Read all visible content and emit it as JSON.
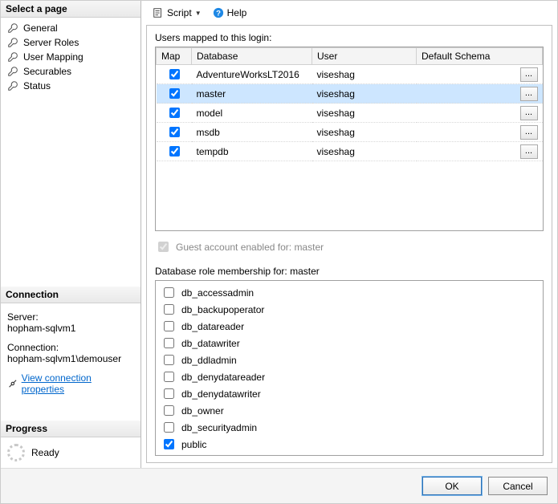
{
  "left": {
    "select_page_header": "Select a page",
    "nav": [
      {
        "label": "General"
      },
      {
        "label": "Server Roles"
      },
      {
        "label": "User Mapping"
      },
      {
        "label": "Securables"
      },
      {
        "label": "Status"
      }
    ],
    "connection_header": "Connection",
    "server_label": "Server:",
    "server_value": "hopham-sqlvm1",
    "connection_label": "Connection:",
    "connection_value": "hopham-sqlvm1\\demouser",
    "view_conn_link": "View connection properties",
    "progress_header": "Progress",
    "progress_status": "Ready"
  },
  "toolbar": {
    "script_label": "Script",
    "help_label": "Help"
  },
  "mapping": {
    "label": "Users mapped to this login:",
    "columns": {
      "map": "Map",
      "database": "Database",
      "user": "User",
      "schema": "Default Schema"
    },
    "rows": [
      {
        "checked": true,
        "database": "AdventureWorksLT2016",
        "user": "viseshag",
        "schema": "",
        "selected": false
      },
      {
        "checked": true,
        "database": "master",
        "user": "viseshag",
        "schema": "",
        "selected": true
      },
      {
        "checked": true,
        "database": "model",
        "user": "viseshag",
        "schema": "",
        "selected": false
      },
      {
        "checked": true,
        "database": "msdb",
        "user": "viseshag",
        "schema": "",
        "selected": false
      },
      {
        "checked": true,
        "database": "tempdb",
        "user": "viseshag",
        "schema": "",
        "selected": false
      }
    ]
  },
  "guest": {
    "label_prefix": "Guest account enabled for:",
    "database": "master",
    "checked": true,
    "enabled": false
  },
  "roles": {
    "label_prefix": "Database role membership for:",
    "database": "master",
    "items": [
      {
        "name": "db_accessadmin",
        "checked": false
      },
      {
        "name": "db_backupoperator",
        "checked": false
      },
      {
        "name": "db_datareader",
        "checked": false
      },
      {
        "name": "db_datawriter",
        "checked": false
      },
      {
        "name": "db_ddladmin",
        "checked": false
      },
      {
        "name": "db_denydatareader",
        "checked": false
      },
      {
        "name": "db_denydatawriter",
        "checked": false
      },
      {
        "name": "db_owner",
        "checked": false
      },
      {
        "name": "db_securityadmin",
        "checked": false
      },
      {
        "name": "public",
        "checked": true
      }
    ]
  },
  "buttons": {
    "ok": "OK",
    "cancel": "Cancel"
  },
  "ellipsis": "..."
}
